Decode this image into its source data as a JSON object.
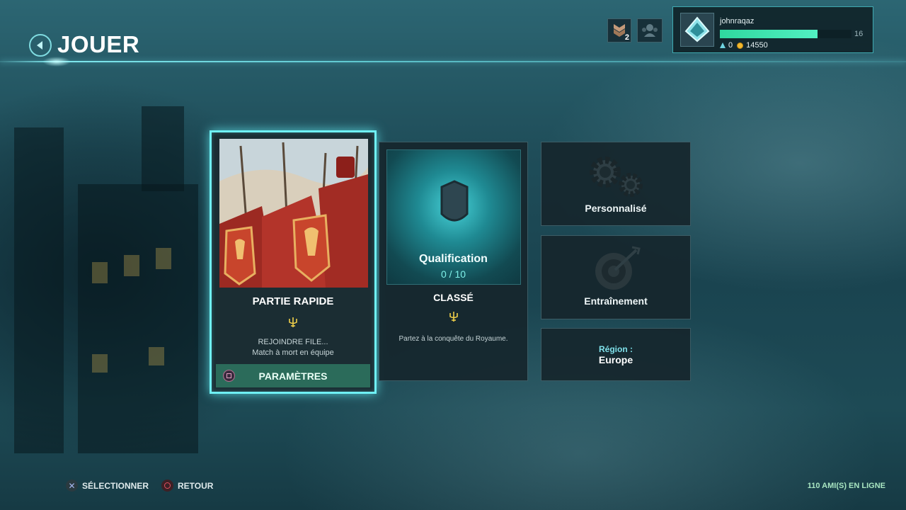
{
  "header": {
    "title": "JOUER"
  },
  "hud": {
    "rank_count": "2"
  },
  "profile": {
    "username": "johnraqaz",
    "level": "16",
    "xp_progress": 0.74,
    "gems": "0",
    "gold": "14550"
  },
  "modes": {
    "quick": {
      "title": "PARTIE RAPIDE",
      "status": "REJOINDRE FILE...",
      "mode": "Match à mort en équipe",
      "settings_label": "PARAMÈTRES"
    },
    "ranked": {
      "qualification": "Qualification",
      "progress": "0 / 10",
      "title": "CLASSÉ",
      "description": "Partez à la conquête du Royaume."
    },
    "custom": {
      "label": "Personnalisé"
    },
    "training": {
      "label": "Entraînement"
    },
    "region": {
      "key": "Région :",
      "value": "Europe"
    }
  },
  "footer": {
    "select_label": "SÉLECTIONNER",
    "back_label": "RETOUR",
    "friends_online": "110 AMI(S) EN LIGNE"
  },
  "colors": {
    "accent": "#6ff0f4",
    "xp_bar": "#3fe0ad",
    "settings_button": "#2b6b5a"
  }
}
